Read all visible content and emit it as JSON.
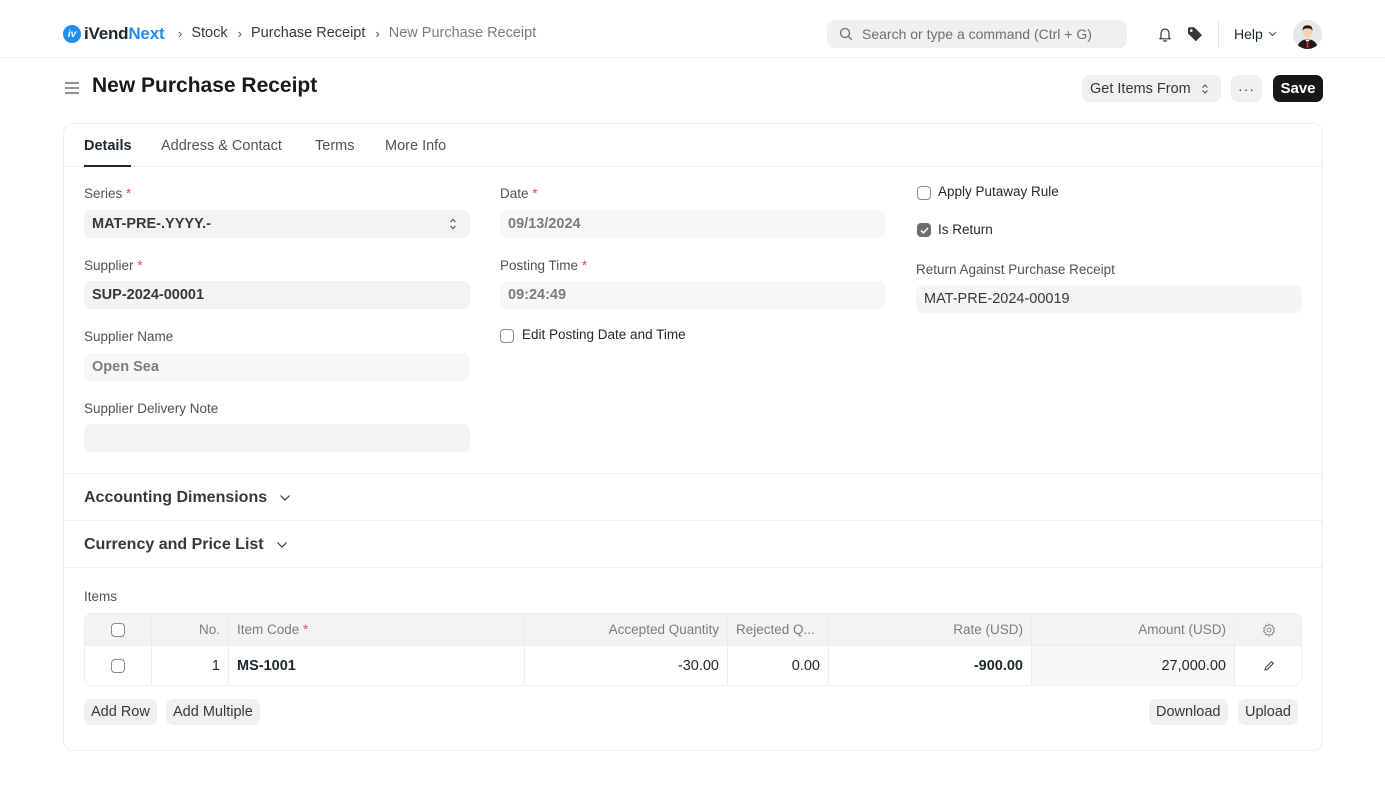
{
  "navbar": {
    "brand_main": "iVend",
    "brand_accent": "Next",
    "brand_icon": "iv-logo-icon",
    "breadcrumbs": [
      "Stock",
      "Purchase Receipt",
      "New Purchase Receipt"
    ],
    "search_placeholder": "Search or type a command (Ctrl + G)",
    "help_label": "Help",
    "icons": [
      "search-icon",
      "bell-icon",
      "tag-icon",
      "chevron-down-icon",
      "user-avatar"
    ]
  },
  "page": {
    "title": "New Purchase Receipt",
    "get_items_label": "Get Items From",
    "more_label": "···",
    "save_label": "Save"
  },
  "tabs": [
    "Details",
    "Address & Contact",
    "Terms",
    "More Info"
  ],
  "active_tab": "Details",
  "fields": {
    "series": {
      "label": "Series",
      "required": "*",
      "value": "MAT-PRE-.YYYY.-"
    },
    "supplier": {
      "label": "Supplier",
      "required": "*",
      "value": "SUP-2024-00001"
    },
    "supplier_name": {
      "label": "Supplier Name",
      "value": "Open Sea"
    },
    "supplier_delivery_note": {
      "label": "Supplier Delivery Note",
      "value": ""
    },
    "date": {
      "label": "Date",
      "required": "*",
      "value": "09/13/2024"
    },
    "posting_time": {
      "label": "Posting Time",
      "required": "*",
      "value": "09:24:49"
    },
    "edit_posting": {
      "label": "Edit Posting Date and Time",
      "checked": false
    },
    "apply_putaway": {
      "label": "Apply Putaway Rule",
      "checked": false
    },
    "is_return": {
      "label": "Is Return",
      "checked": true
    },
    "return_against": {
      "label": "Return Against Purchase Receipt",
      "value": "MAT-PRE-2024-00019"
    }
  },
  "sections": {
    "accounting_dimensions": "Accounting Dimensions",
    "currency_price_list": "Currency and Price List"
  },
  "items": {
    "label": "Items",
    "columns": [
      "No.",
      "Item Code",
      "Accepted Quantity",
      "Rejected Q...",
      "Rate (USD)",
      "Amount (USD)"
    ],
    "item_code_required": "*",
    "rows": [
      {
        "no": "1",
        "item_code": "MS-1001",
        "accepted_qty": "-30.00",
        "rejected_qty": "0.00",
        "rate": "-900.00",
        "amount": "27,000.00"
      }
    ],
    "add_row_label": "Add Row",
    "add_multiple_label": "Add Multiple",
    "download_label": "Download",
    "upload_label": "Upload"
  },
  "colors": {
    "brand": "#1f8ef1",
    "primary_button": "#171717",
    "required": "#e24c4c"
  }
}
